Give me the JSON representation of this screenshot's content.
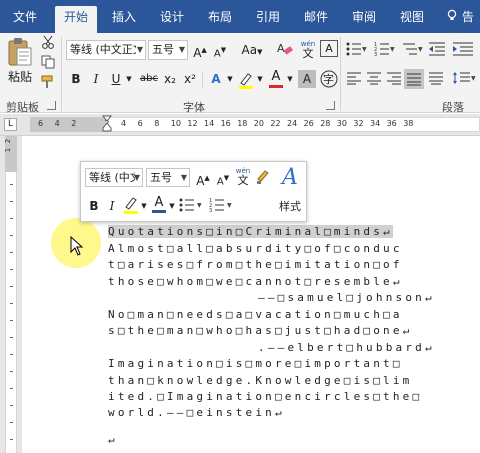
{
  "tabs": [
    {
      "label": "文件",
      "active": false
    },
    {
      "label": "开始",
      "active": true
    },
    {
      "label": "插入",
      "active": false
    },
    {
      "label": "设计",
      "active": false
    },
    {
      "label": "布局",
      "active": false
    },
    {
      "label": "引用",
      "active": false
    },
    {
      "label": "邮件",
      "active": false
    },
    {
      "label": "审阅",
      "active": false
    },
    {
      "label": "视图",
      "active": false
    }
  ],
  "tell_me": "告诉",
  "ribbon": {
    "clipboard": {
      "paste_label": "粘贴",
      "group_label": "剪贴板"
    },
    "font": {
      "font_name": "等线 (中文正文)",
      "font_size": "五号",
      "wen_top": "wén",
      "wen_bottom": "文",
      "change_case": "Aa",
      "group_label": "字体",
      "bold": "B",
      "italic": "I",
      "underline": "U",
      "strike": "abc",
      "subscript": "x₂",
      "superscript": "x²",
      "char_border": "A",
      "enlarge": "A",
      "shrink": "A",
      "text_effects": "A",
      "font_color": "A",
      "char_shading": "A",
      "enclose": "字"
    },
    "paragraph": {
      "group_label": "段落"
    }
  },
  "ruler": {
    "numbers": [
      "6",
      "4",
      "2",
      "2",
      "4",
      "6",
      "8",
      "10",
      "12",
      "14",
      "16",
      "18",
      "20",
      "22",
      "24",
      "26",
      "28",
      "30",
      "32",
      "34",
      "36",
      "38"
    ],
    "tab_selector": "L",
    "vertical_numbers": [
      "1",
      "2"
    ]
  },
  "mini_toolbar": {
    "font_name": "等线 (中文",
    "font_size": "五号",
    "bold": "B",
    "italic": "I",
    "styles_label": "样式",
    "wen_top": "wén",
    "wen_bottom": "文",
    "enlarge": "A",
    "shrink": "A",
    "font_color": "A",
    "styles_icon": "A"
  },
  "document": {
    "lines": [
      "Quotations□in□Criminal□minds↵",
      "Almost□all□absurdity□of□conduc",
      "t□arises□from□the□imitation□of",
      "those□whom□we□cannot□resemble↵",
      "——□samuel□johnson↵",
      "No□man□needs□a□vacation□much□a",
      "s□the□man□who□has□just□had□one↵",
      ".——elbert□hubbard↵",
      "Imagination□is□more□important□",
      "than□knowledge.Knowledge□is□lim",
      "ited.□Imagination□encircles□the□",
      "world.——□einstein↵",
      "↵"
    ]
  },
  "colors": {
    "tabbar": "#2b579a",
    "ribbon": "#f3f3f3",
    "text_effect": "#2b6fce",
    "font_color_bar": "#d92b2b",
    "highlight_bar": "#ffff00",
    "cursor_halo": "#fff778"
  }
}
